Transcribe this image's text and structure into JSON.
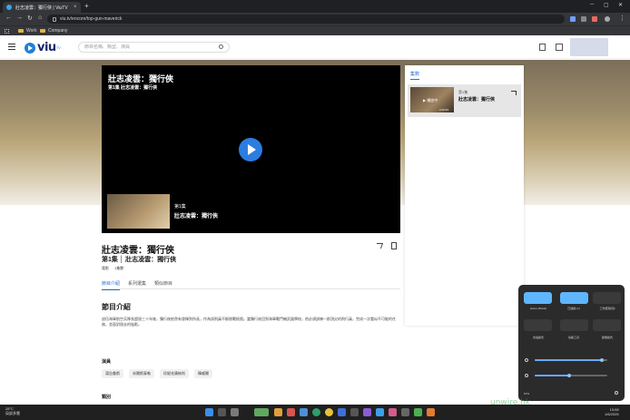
{
  "browser": {
    "tab_title": "壯志凌雲：獨行俠 | ViuTV",
    "url": "viu.tv/encore/top-gun-maverick",
    "bookmarks": [
      "Work",
      "Company"
    ]
  },
  "header": {
    "logo": "viu",
    "logo_sup": "TV",
    "search_placeholder": "節目名稱、類型、演員"
  },
  "player": {
    "title": "壯志凌雲：獨行俠",
    "subtitle": "第1集 壯志凌雲：獨行俠",
    "upnext_ep": "第1集",
    "upnext_title": "壯志凌雲：獨行俠"
  },
  "show": {
    "title": "壯志凌雲：獨行俠",
    "subtitle": "第1集 │ 壯志凌雲：獨行俠",
    "tags": [
      "電影",
      "1集數"
    ],
    "tabs": [
      "節目介紹",
      "系列選集",
      "類似節目"
    ],
    "section_title": "節目介紹",
    "synopsis": "退伍海軍航空兵隊長超過三十年後，獨行俠依然有發揮到所長，作為試飛員不斷挑戰極限。當獨行俠回到海軍戰鬥機武器學校，他必須訓練一群頂尖的飛行員，完成一次看似不可能的任務，並面對過去的陰影。",
    "cast_title": "演員",
    "cast": [
      "湯告魯斯",
      "米爾斯泰勒",
      "珍妮花康納利",
      "韓威爾"
    ],
    "category_title": "類別"
  },
  "episodes": {
    "tab": "集數",
    "item": {
      "playing": "▶ 播放中",
      "duration": "2:10:33",
      "number": "第1集",
      "title": "壯志凌雲：獨行俠"
    }
  },
  "quick_settings": {
    "labels": [
      "Home (5GHz)",
      "已連線 (1)",
      "工作選項(閉)",
      "省電模式",
      "協助工具",
      "節能模式"
    ],
    "battery": "67%",
    "brightness_level": 0.92,
    "volume_level": 0.48
  },
  "taskbar": {
    "weather_temp": "28°C",
    "weather_desc": "局部多雲",
    "time": "13:08",
    "date": "1/6/2025"
  },
  "watermark": "unwire.hk"
}
